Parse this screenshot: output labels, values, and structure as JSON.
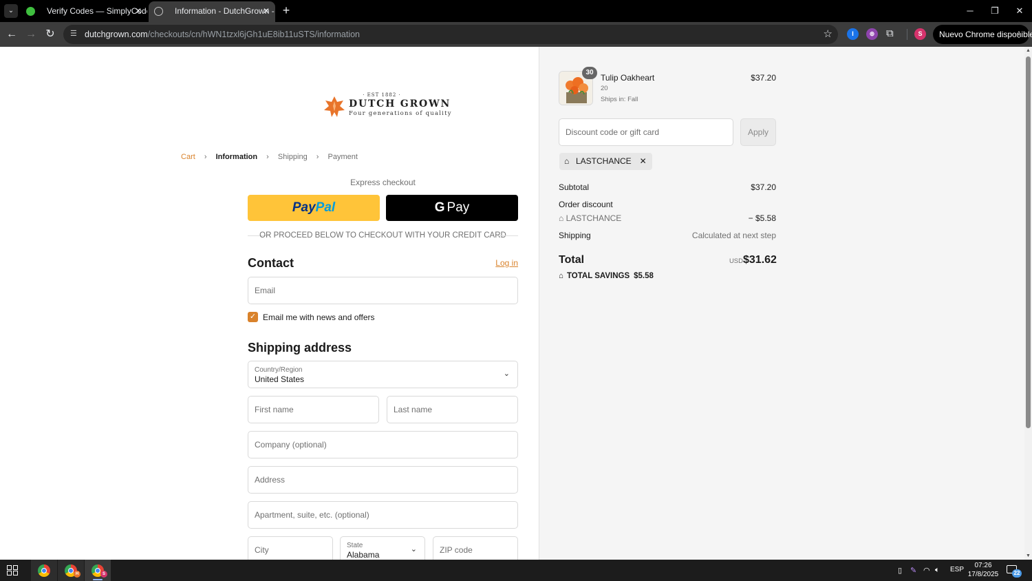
{
  "browser": {
    "tabs": [
      {
        "title": "Verify Codes — SimplyCodes",
        "favicon": "simplycodes-check-icon",
        "active": false
      },
      {
        "title": "Information - DutchGrown - Ch",
        "favicon": "globe-icon",
        "active": true
      }
    ],
    "new_tab_label": "+",
    "url_host": "dutchgrown.com",
    "url_path": "/checkouts/cn/hWN1tzxl6jGh1uE8ib11uSTS/information",
    "update_button": "Nuevo Chrome disponible",
    "extensions": [
      {
        "name": "password-manager-icon",
        "letter": "I",
        "color": "#1a73e8"
      },
      {
        "name": "purple-extension-icon",
        "letter": "⊚",
        "color": "#8e44ad"
      }
    ],
    "profile_letter": "S",
    "profile_color": "#d6336c"
  },
  "checkout": {
    "logo": {
      "est": "· EST 1882 ·",
      "name": "DUTCH GROWN",
      "tagline": "Four generations of quality"
    },
    "breadcrumb": {
      "cart": "Cart",
      "information": "Information",
      "shipping": "Shipping",
      "payment": "Payment"
    },
    "express_checkout": "Express checkout",
    "paypal": {
      "part1": "Pay",
      "part2": "Pal"
    },
    "gpay_label": "Pay",
    "or_divider": "OR PROCEED BELOW TO CHECKOUT WITH YOUR CREDIT CARD",
    "contact": {
      "title": "Contact",
      "login": "Log in",
      "email_placeholder": "Email",
      "newsletter_label": "Email me with news and offers",
      "newsletter_checked": true
    },
    "shipping": {
      "title": "Shipping address",
      "country_label": "Country/Region",
      "country_value": "United States",
      "first_name": "First name",
      "last_name": "Last name",
      "company": "Company (optional)",
      "address": "Address",
      "apartment": "Apartment, suite, etc. (optional)",
      "city": "City",
      "state_label": "State",
      "state_value": "Alabama",
      "zip": "ZIP code"
    }
  },
  "summary": {
    "product": {
      "name": "Tulip Oakheart",
      "quantity": "30",
      "variant": "20",
      "ships": "Ships in: Fall",
      "price": "$37.20"
    },
    "discount_placeholder": "Discount code or gift card",
    "apply_label": "Apply",
    "applied_code": "LASTCHANCE",
    "subtotal_label": "Subtotal",
    "subtotal_value": "$37.20",
    "order_discount_label": "Order discount",
    "discount_code": "LASTCHANCE",
    "discount_value": "− $5.58",
    "shipping_label": "Shipping",
    "shipping_value": "Calculated at next step",
    "total_label": "Total",
    "currency": "USD",
    "total_value": "$31.62",
    "savings_label": "TOTAL SAVINGS",
    "savings_value": "$5.58"
  },
  "taskbar": {
    "language": "ESP",
    "time": "07:26",
    "date": "17/8/2025",
    "notifications": "22",
    "apps": [
      {
        "name": "chrome-app",
        "badge": ""
      },
      {
        "name": "chrome-app-h",
        "badge": "H"
      },
      {
        "name": "chrome-app-s",
        "badge": "S"
      }
    ]
  },
  "colors": {
    "accent": "#d9822b",
    "paypal_yellow": "#ffc439"
  }
}
